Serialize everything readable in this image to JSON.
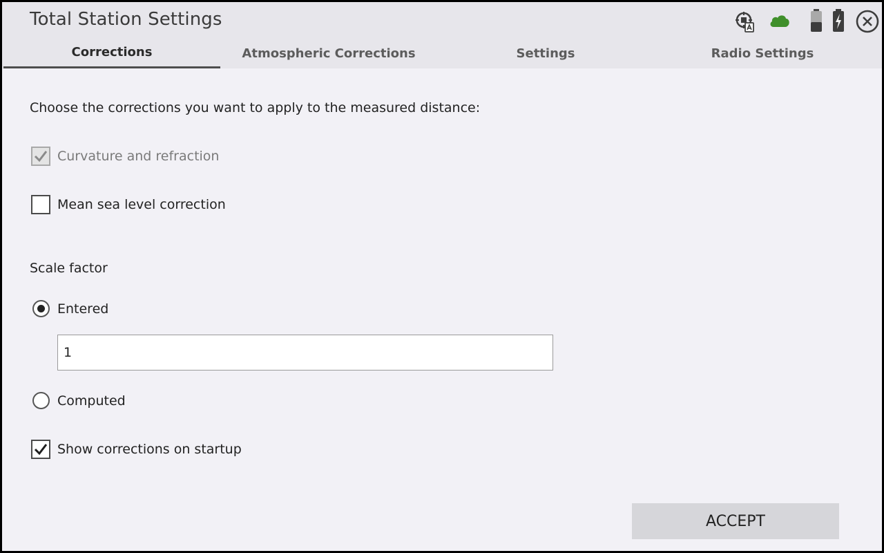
{
  "window": {
    "title": "Total Station Settings"
  },
  "status_icons": {
    "instrument": "survey-instrument-icon",
    "cloud": "cloud-icon",
    "cloud_color": "#3f8f2a",
    "battery_1": "battery-icon",
    "battery_2": "battery-charging-icon",
    "close": "close-icon"
  },
  "tabs": [
    {
      "label": "Corrections",
      "active": true
    },
    {
      "label": "Atmospheric Corrections",
      "active": false
    },
    {
      "label": "Settings",
      "active": false
    },
    {
      "label": "Radio Settings",
      "active": false
    }
  ],
  "corrections": {
    "instruction": "Choose the corrections you want to apply to the measured distance:",
    "curvature": {
      "label": "Curvature and refraction",
      "checked": true,
      "disabled": true
    },
    "mean_sea_level": {
      "label": "Mean sea level correction",
      "checked": false
    }
  },
  "scale_factor": {
    "label": "Scale factor",
    "entered": {
      "label": "Entered",
      "selected": true
    },
    "value": "1",
    "computed": {
      "label": "Computed",
      "selected": false
    }
  },
  "show_on_startup": {
    "label": "Show corrections on startup",
    "checked": true
  },
  "actions": {
    "accept_label": "ACCEPT"
  }
}
